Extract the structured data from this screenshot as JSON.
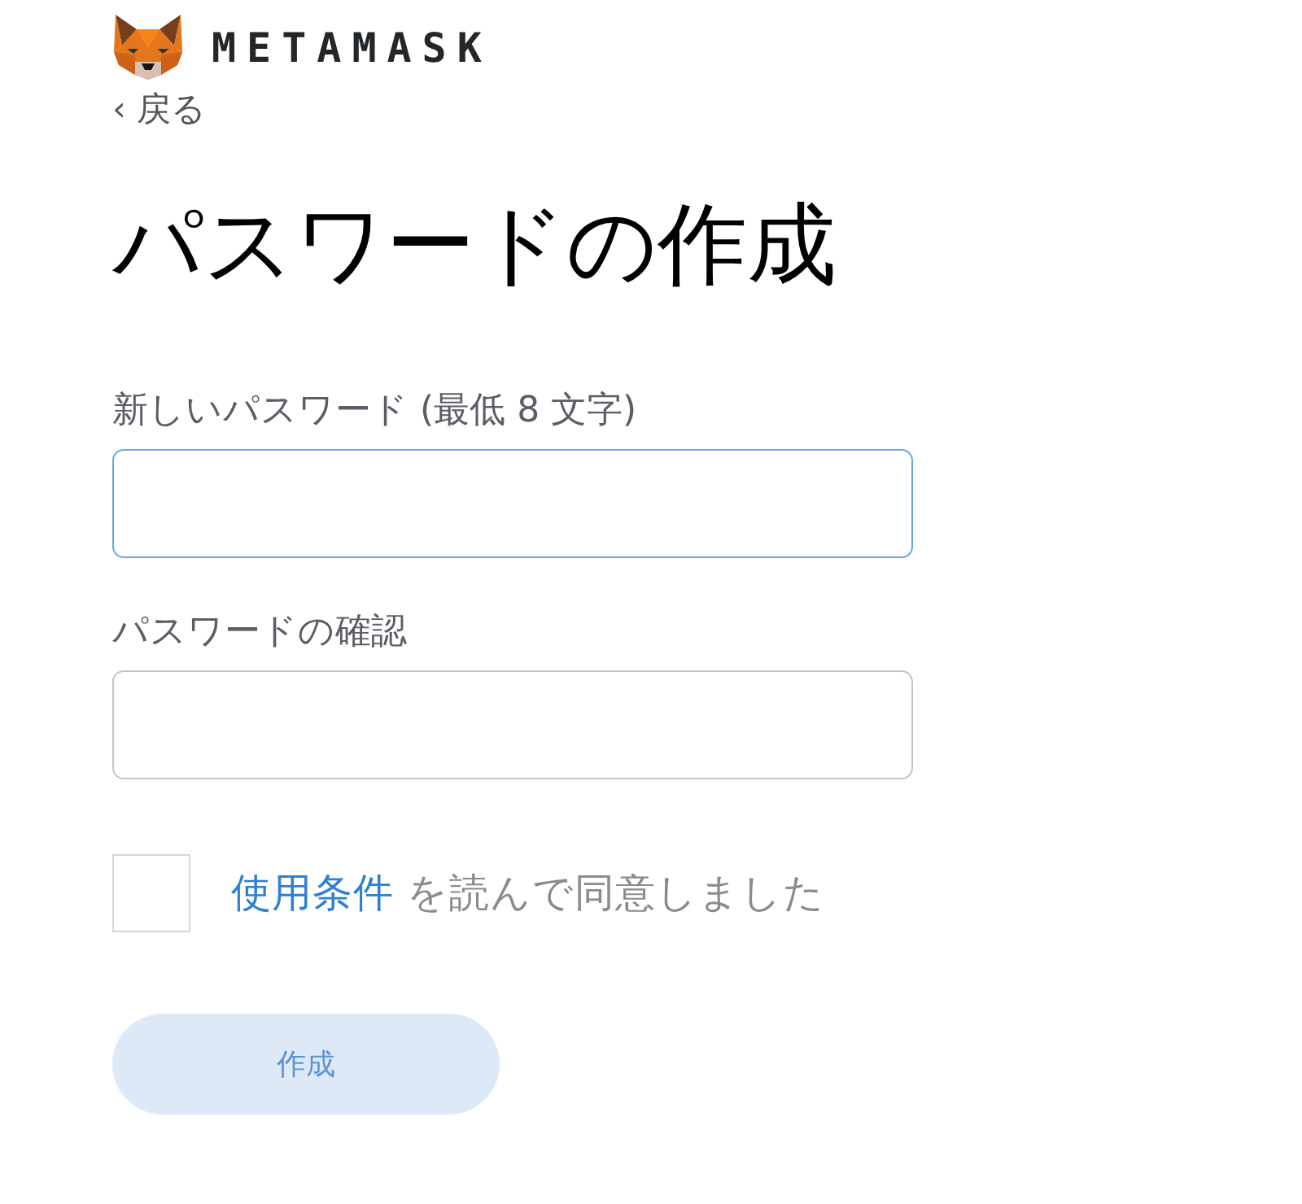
{
  "header": {
    "logo_text": "METAMASK"
  },
  "back_link": {
    "label": "‹ 戻る"
  },
  "title": "パスワードの作成",
  "fields": [
    {
      "label": "新しいパスワード (最低 8 文字)",
      "focused": true
    },
    {
      "label": "パスワードの確認",
      "focused": false
    }
  ],
  "terms": {
    "checked": false,
    "link": "使用条件",
    "text": "を読んで同意しました"
  },
  "create_button": {
    "label": "作成",
    "disabled": true
  }
}
